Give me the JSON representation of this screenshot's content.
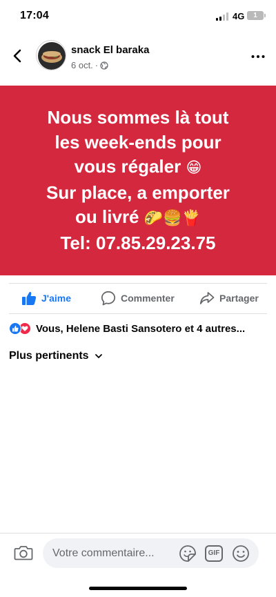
{
  "status_bar": {
    "time": "17:04",
    "network": "4G",
    "battery_level": "1"
  },
  "post": {
    "author": "snack El baraka",
    "date": "6 oct.",
    "separator": "·",
    "audience_icon": "globe-icon",
    "lines": [
      {
        "text": "Nous sommes là tout",
        "emoji": ""
      },
      {
        "text": "les week-ends pour",
        "emoji": ""
      },
      {
        "text": "vous régaler",
        "emoji": "😁"
      },
      {
        "text": "Sur place, a emporter",
        "emoji": ""
      },
      {
        "text": "ou livré",
        "emoji": "🌮🍔🍟"
      },
      {
        "text": "Tel: 07.85.29.23.75",
        "emoji": ""
      }
    ],
    "background_color": "#d4283f"
  },
  "actions": {
    "like_label": "J'aime",
    "comment_label": "Commenter",
    "share_label": "Partager"
  },
  "reactions": {
    "icons": [
      "like-reaction-icon",
      "love-reaction-icon"
    ],
    "summary": "Vous, Helene Basti Sansotero et 4 autres..."
  },
  "comments": {
    "sort_label": "Plus pertinents"
  },
  "composer": {
    "placeholder": "Votre commentaire...",
    "gif_label": "GIF"
  },
  "colors": {
    "brand_blue": "#1877f2",
    "love_red": "#f0284a",
    "secondary_text": "#65676b"
  }
}
